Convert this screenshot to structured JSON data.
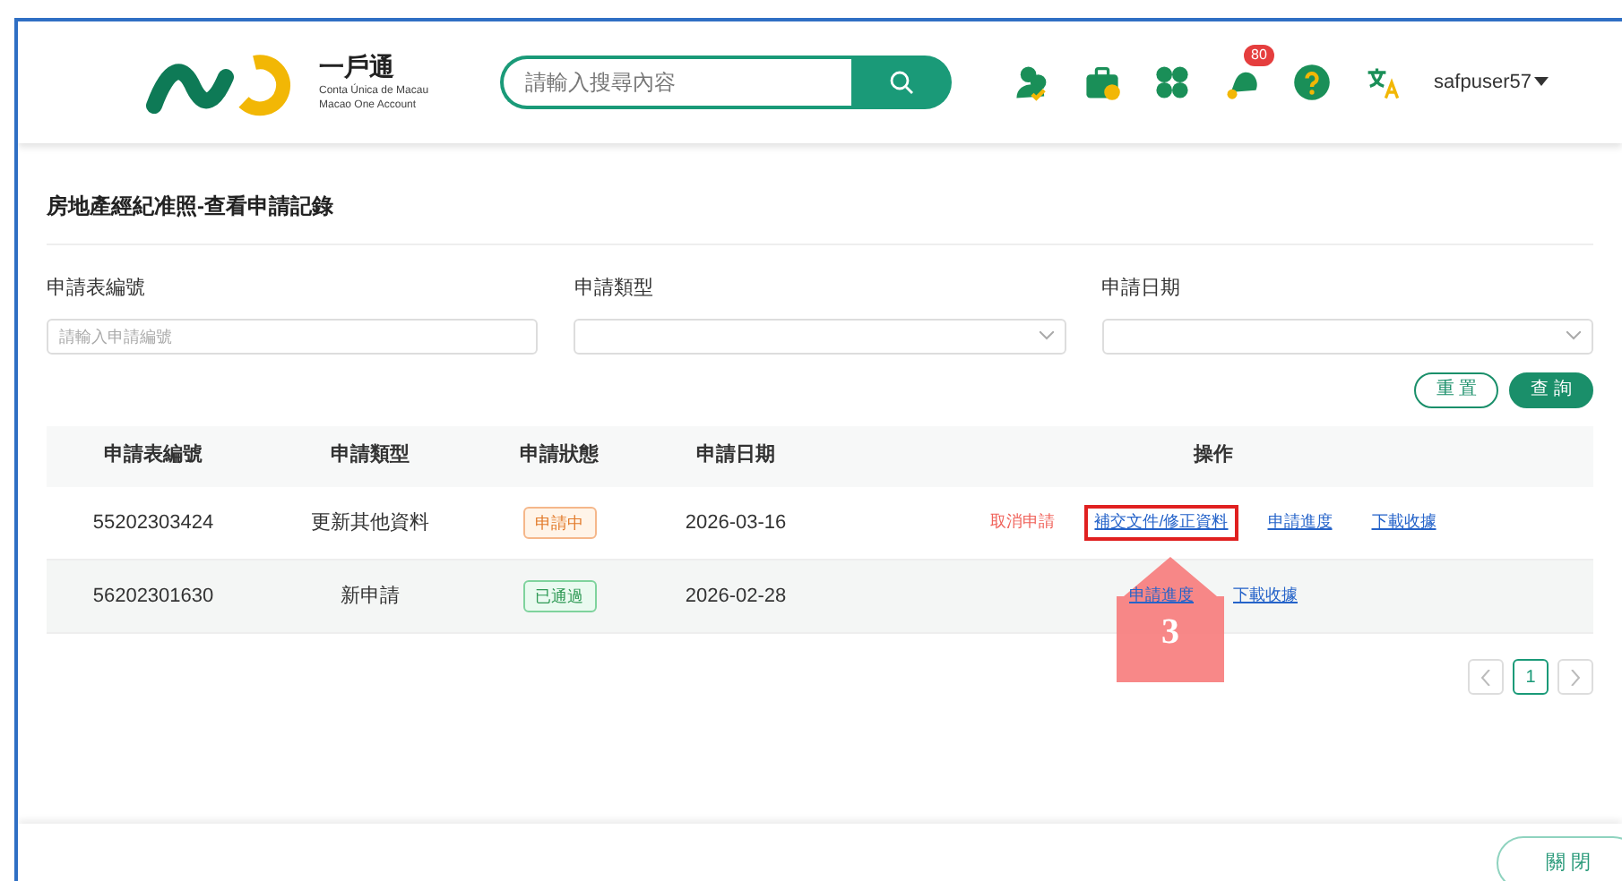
{
  "header": {
    "logo_title": "一戶通",
    "logo_subtitles": [
      "Conta Única de Macau",
      "Macao One Account"
    ],
    "search": {
      "placeholder": "請輸入搜尋內容"
    },
    "icons": [
      {
        "kind": "people"
      },
      {
        "kind": "briefcase"
      },
      {
        "kind": "clover"
      },
      {
        "kind": "bell",
        "badge": "80"
      },
      {
        "kind": "help"
      },
      {
        "kind": "translate"
      }
    ],
    "user": "safpuser57"
  },
  "page_title": "房地產經紀准照-查看申請記錄",
  "filters": [
    {
      "label": "申請表編號",
      "kind": "text",
      "placeholder": "請輸入申請編號"
    },
    {
      "label": "申請類型",
      "kind": "select"
    },
    {
      "label": "申請日期",
      "kind": "select"
    }
  ],
  "filter_buttons": [
    {
      "label": "重 置",
      "kind": "outline"
    },
    {
      "label": "查 詢",
      "kind": "primary"
    }
  ],
  "table": {
    "columns": [
      "申請表編號",
      "申請類型",
      "申請狀態",
      "申請日期",
      "操作"
    ],
    "rows": [
      {
        "number": "55202303424",
        "type": "更新其他資料",
        "status": {
          "text": "申請中",
          "kind": "pending"
        },
        "date": "2026-03-16",
        "actions": [
          {
            "label": "取消申請",
            "kind": "danger",
            "highlighted": false
          },
          {
            "label": "補交文件/修正資料",
            "kind": "link",
            "highlighted": true
          },
          {
            "label": "申請進度",
            "kind": "link",
            "highlighted": false
          },
          {
            "label": "下載收據",
            "kind": "link",
            "highlighted": false
          }
        ]
      },
      {
        "number": "56202301630",
        "type": "新申請",
        "status": {
          "text": "已通過",
          "kind": "approved"
        },
        "date": "2026-02-28",
        "actions": [
          {
            "label": "申請進度",
            "kind": "link",
            "highlighted": false
          },
          {
            "label": "下載收據",
            "kind": "link",
            "highlighted": false
          }
        ]
      }
    ]
  },
  "pagination": {
    "pages": [
      {
        "label": "1",
        "selected": true
      }
    ]
  },
  "annotation": {
    "step": "3"
  },
  "close_button": "關 閉"
}
